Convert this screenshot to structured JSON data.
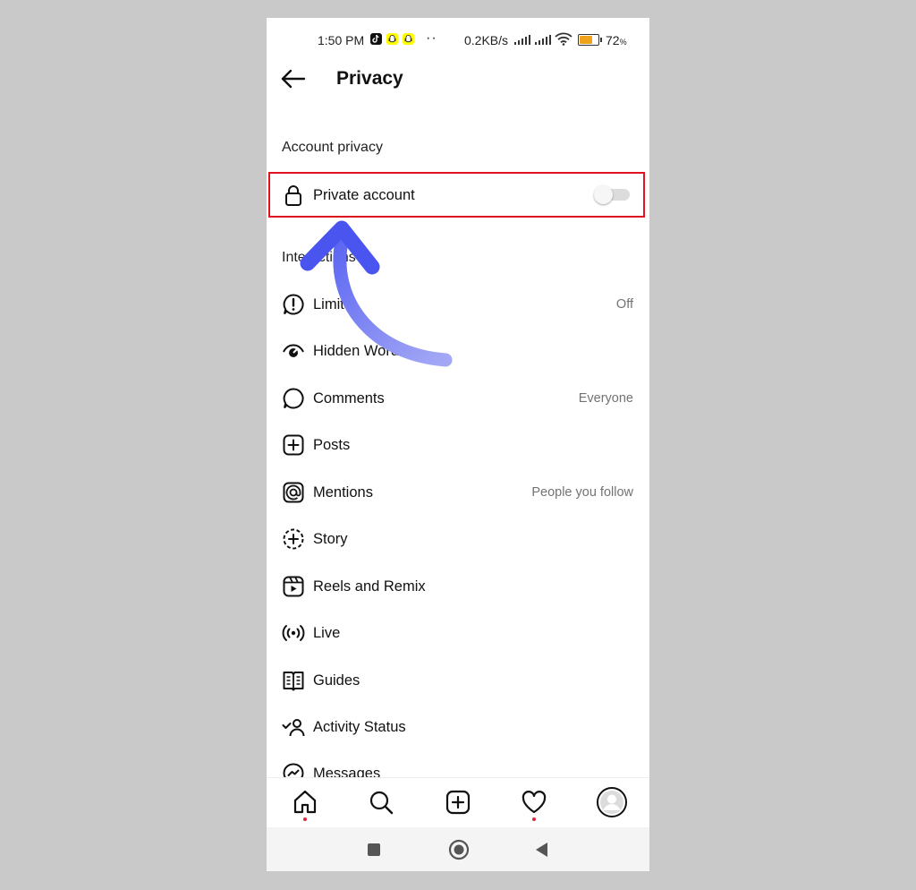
{
  "status_bar": {
    "time": "1:50 PM",
    "speed": "0.2KB/s",
    "battery_pct": "72",
    "battery_pct_sign": "%",
    "battery_level": 0.72,
    "colors": {
      "battery_fill": "#f0a31a",
      "snapchat": "#fffc00",
      "tiktok": "#111111"
    },
    "icons": [
      "tiktok-icon",
      "snapchat-icon",
      "snapchat-icon",
      "signal-icon",
      "signal-icon",
      "wifi-icon",
      "battery-icon"
    ]
  },
  "header": {
    "title": "Privacy",
    "back_icon": "back-arrow-icon"
  },
  "sections": {
    "account_privacy": "Account privacy",
    "interactions": "Interactions"
  },
  "private_account": {
    "label": "Private account",
    "icon": "lock-icon",
    "enabled": false
  },
  "interactions": [
    {
      "label": "Limits",
      "value": "Off",
      "icon": "limits-icon"
    },
    {
      "label": "Hidden Words",
      "value": "",
      "icon": "hidden-words-icon"
    },
    {
      "label": "Comments",
      "value": "Everyone",
      "icon": "comment-icon"
    },
    {
      "label": "Posts",
      "value": "",
      "icon": "plus-square-icon"
    },
    {
      "label": "Mentions",
      "value": "People you follow",
      "icon": "at-sign-icon"
    },
    {
      "label": "Story",
      "value": "",
      "icon": "story-plus-icon"
    },
    {
      "label": "Reels and Remix",
      "value": "",
      "icon": "reels-icon"
    },
    {
      "label": "Live",
      "value": "",
      "icon": "live-icon"
    },
    {
      "label": "Guides",
      "value": "",
      "icon": "guides-icon"
    },
    {
      "label": "Activity Status",
      "value": "",
      "icon": "activity-status-icon"
    },
    {
      "label": "Messages",
      "value": "",
      "icon": "messenger-icon"
    }
  ],
  "bottom_nav": [
    "home-icon",
    "search-icon",
    "create-icon",
    "heart-icon",
    "profile-avatar"
  ],
  "system_nav": [
    "recents-button",
    "home-button",
    "back-button"
  ],
  "annotation": {
    "highlight_color": "#e0141e",
    "arrow_color": "#4a55f0"
  }
}
